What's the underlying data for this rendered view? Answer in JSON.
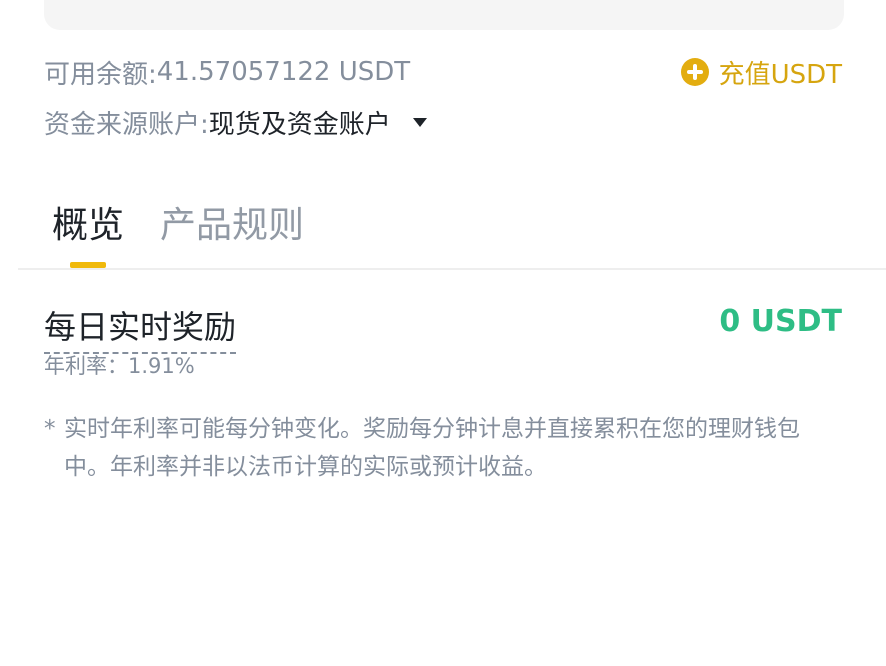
{
  "balance": {
    "label": "可用余额: ",
    "value": "41.57057122 USDT"
  },
  "deposit": {
    "icon": "plus-circle-icon",
    "label": "充值USDT",
    "color": "#e3ad10"
  },
  "funding_source": {
    "label": "资金来源账户: ",
    "value": "现货及资金账户",
    "icon": "caret-down-icon"
  },
  "tabs": [
    {
      "label": "概览",
      "active": true
    },
    {
      "label": "产品规则",
      "active": false
    }
  ],
  "reward": {
    "title": "每日实时奖励",
    "value": "0 USDT",
    "apr": "年利率：1.91%"
  },
  "note": {
    "marker": "*",
    "text": "实时年利率可能每分钟变化。奖励每分钟计息并直接累积在您的理财钱包中。年利率并非以法币计算的实际或预计收益。"
  },
  "colors": {
    "accent": "#f0b90b",
    "positive": "#2ebd85",
    "muted": "#848e9c"
  }
}
